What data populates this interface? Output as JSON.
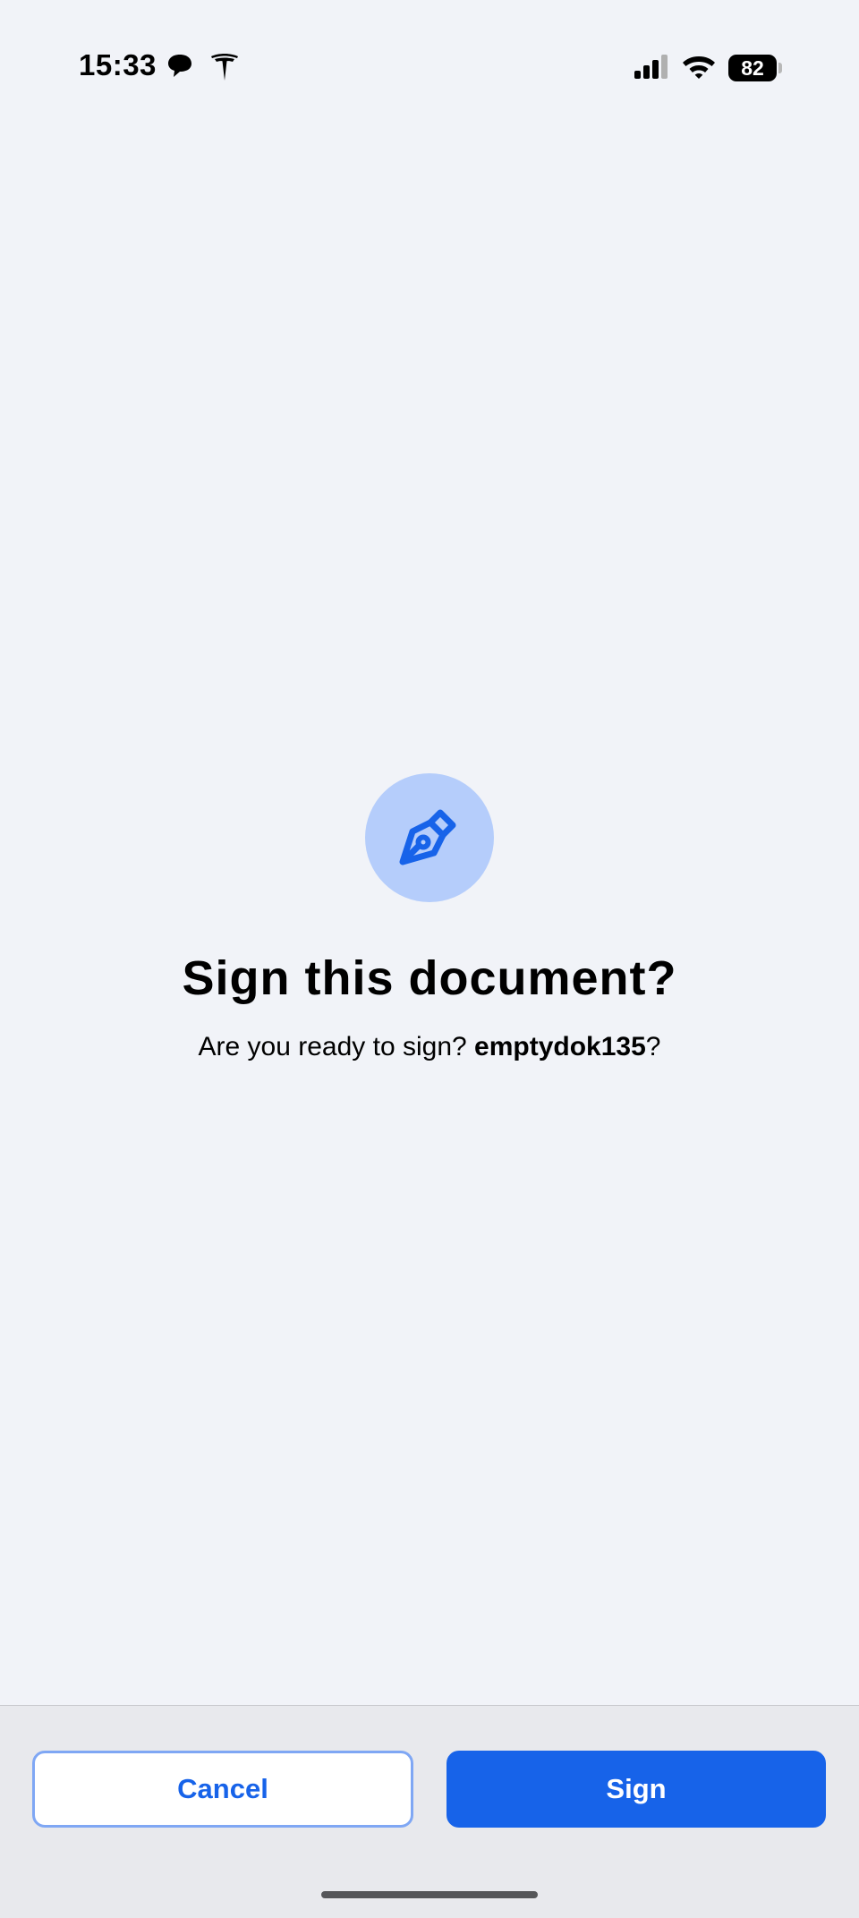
{
  "status_bar": {
    "time": "15:33",
    "battery_level": "82",
    "icons": [
      "chat-bubble-icon",
      "tesla-icon",
      "cellular-signal-icon",
      "wifi-icon",
      "battery-icon"
    ]
  },
  "dialog": {
    "icon": "fountain-pen-icon",
    "title": "Sign this document?",
    "message_prefix": "Are you ready to sign? ",
    "document_name": "emptydok135",
    "message_suffix": "?"
  },
  "actions": {
    "cancel_label": "Cancel",
    "sign_label": "Sign"
  },
  "colors": {
    "accent": "#1763e9",
    "icon_circle": "#b5cdfb",
    "background": "#f1f3f8",
    "bottom_bar": "#e8e9ed"
  }
}
